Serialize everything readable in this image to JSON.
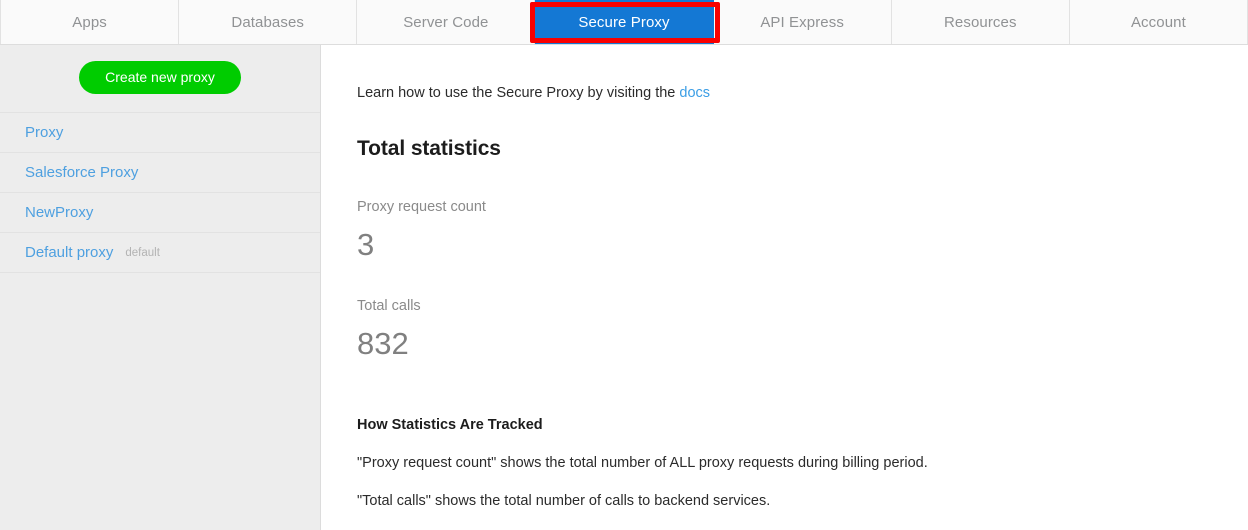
{
  "tabs": [
    {
      "label": "Apps",
      "active": false
    },
    {
      "label": "Databases",
      "active": false
    },
    {
      "label": "Server Code",
      "active": false
    },
    {
      "label": "Secure Proxy",
      "active": true
    },
    {
      "label": "API Express",
      "active": false
    },
    {
      "label": "Resources",
      "active": false
    },
    {
      "label": "Account",
      "active": false
    }
  ],
  "annotation": {
    "color": "#f90000",
    "target": "Secure Proxy"
  },
  "sidebar": {
    "create_button_label": "Create new proxy",
    "create_button_color": "#00cc00",
    "items": [
      {
        "label": "Proxy",
        "badge": ""
      },
      {
        "label": "Salesforce Proxy",
        "badge": ""
      },
      {
        "label": "NewProxy",
        "badge": ""
      },
      {
        "label": "Default proxy",
        "badge": "default"
      }
    ]
  },
  "main": {
    "intro_prefix": "Learn how to use the Secure Proxy by visiting the ",
    "intro_link": "docs",
    "section_title": "Total statistics",
    "stats": [
      {
        "label": "Proxy request count",
        "value": "3"
      },
      {
        "label": "Total calls",
        "value": "832"
      }
    ],
    "tracked_title": "How Statistics Are Tracked",
    "tracked_lines": [
      "\"Proxy request count\" shows the total number of ALL proxy requests during billing period.",
      "\"Total calls\" shows the total number of calls to backend services."
    ]
  },
  "colors": {
    "active_tab": "#1478d4",
    "link": "#3c9ee5",
    "sidebar_link": "#4ea0e0",
    "accent_green": "#00cc00",
    "annotation_red": "#f90000"
  }
}
